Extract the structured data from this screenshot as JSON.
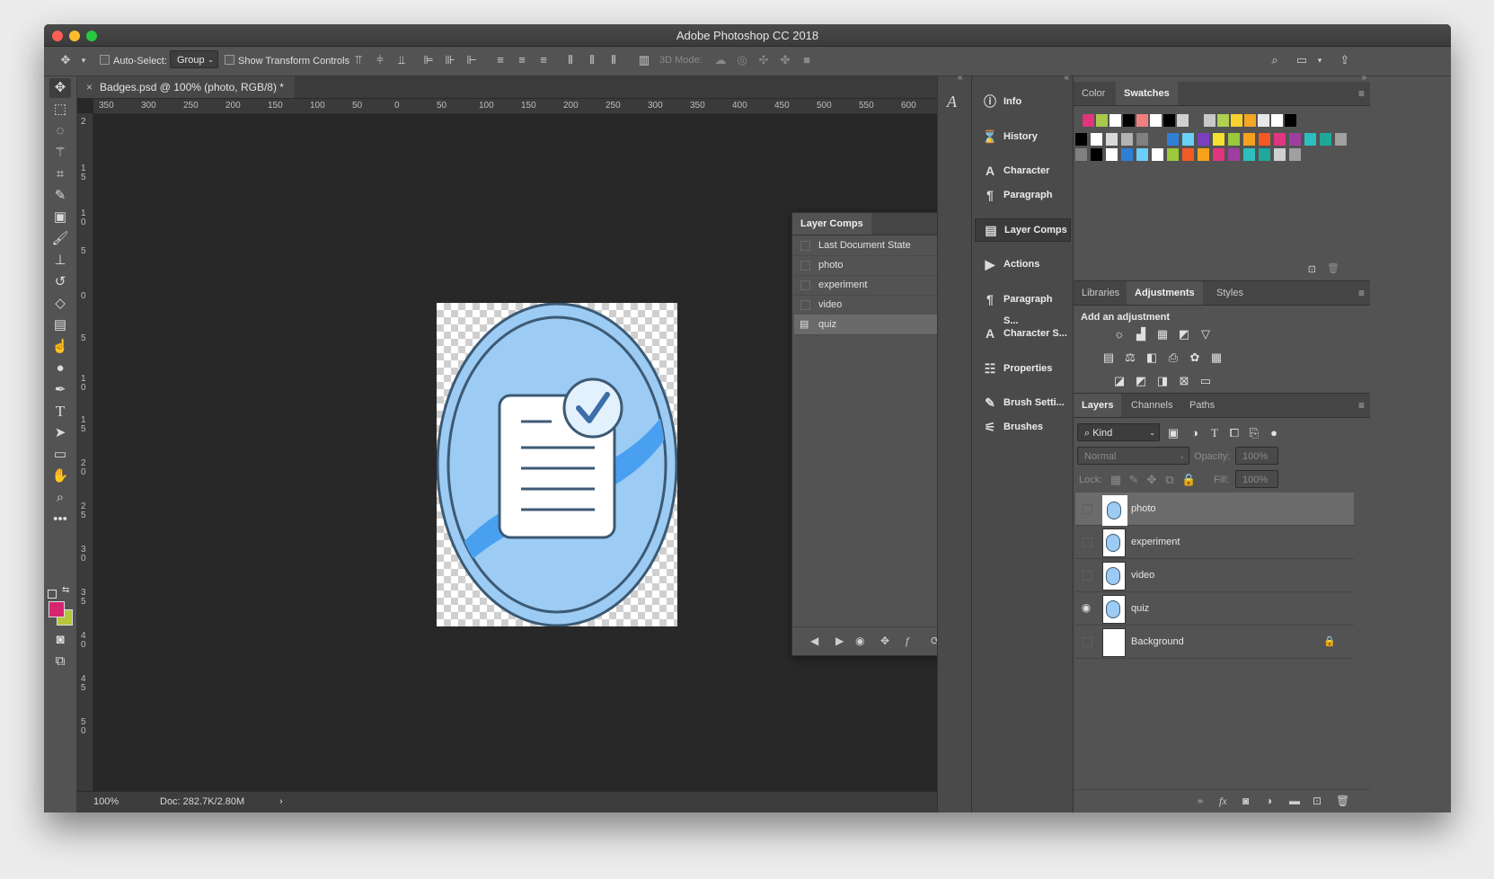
{
  "window": {
    "title": "Adobe Photoshop CC 2018"
  },
  "options": {
    "auto_select_label": "Auto-Select:",
    "auto_select_value": "Group",
    "show_transform_label": "Show Transform Controls",
    "mode_3d_label": "3D Mode:"
  },
  "document": {
    "tab_title": "Badges.psd @ 100% (photo, RGB/8) *",
    "zoom": "100%",
    "doc_size": "Doc: 282.7K/2.80M",
    "ruler_h": [
      "350",
      "300",
      "250",
      "200",
      "150",
      "100",
      "50",
      "0",
      "50",
      "100",
      "150",
      "200",
      "250",
      "300",
      "350",
      "400",
      "450",
      "500",
      "550",
      "600"
    ],
    "ruler_v": [
      "2",
      "1",
      "5",
      "1",
      "0",
      "5",
      "0",
      "5",
      "1",
      "0",
      "1",
      "5",
      "2",
      "0",
      "2",
      "5",
      "3",
      "0",
      "3",
      "5",
      "4",
      "0",
      "4",
      "5",
      "5",
      "0"
    ]
  },
  "layer_comps": {
    "title": "Layer Comps",
    "last_state": "Last Document State",
    "rows": [
      "photo",
      "experiment",
      "video",
      "quiz"
    ],
    "selected_index": 3
  },
  "collapsed_panels": [
    "Info",
    "History",
    "Character",
    "Paragraph",
    "Layer Comps",
    "Actions",
    "Paragraph S...",
    "Character S...",
    "Properties",
    "Brush Setti...",
    "Brushes"
  ],
  "color_panel": {
    "tabs": [
      "Color",
      "Swatches"
    ],
    "active": "Swatches",
    "recent": [
      "#e0357f",
      "#a8c94a",
      "#ffffff",
      "#000000",
      "#f08080",
      "#ffffff",
      "#000000",
      "#d0d0d0",
      "#535353",
      "#c8c8c8",
      "#b0d050",
      "#f6d22e",
      "#f5a623",
      "#e8e8e8",
      "#ffffff",
      "#000000"
    ],
    "row1": [
      "#000000",
      "#ffffff",
      "#d9d9d9",
      "#b3b3b3",
      "#808080",
      "#535353",
      "#2f7fd6",
      "#6ccff6",
      "#7a3fbf",
      "#f6e12e",
      "#9cc83c",
      "#f7a21c",
      "#f15a24",
      "#e0357f",
      "#9e3fa0",
      "#2dbfbf",
      "#1fa89a",
      "#a0a0a0"
    ],
    "row2": [
      "#808080",
      "#000000",
      "#ffffff",
      "#2f7fd6",
      "#6ccff6",
      "#ffffff",
      "#9cc83c",
      "#f15a24",
      "#f7a21c",
      "#e0357f",
      "#9e3fa0",
      "#2dbfbf",
      "#1fa89a",
      "#d0d0d0",
      "#a0a0a0",
      "#535353"
    ]
  },
  "adjustments": {
    "tabs": [
      "Libraries",
      "Adjustments",
      "Styles"
    ],
    "active": "Adjustments",
    "heading": "Add an adjustment"
  },
  "layers_panel": {
    "tabs": [
      "Layers",
      "Channels",
      "Paths"
    ],
    "active": "Layers",
    "filter": "Kind",
    "blend_mode": "Normal",
    "opacity_label": "Opacity:",
    "opacity_value": "100%",
    "lock_label": "Lock:",
    "fill_label": "Fill:",
    "fill_value": "100%",
    "layers": [
      {
        "name": "photo",
        "visible": false,
        "selected": true
      },
      {
        "name": "experiment",
        "visible": false,
        "selected": false
      },
      {
        "name": "video",
        "visible": false,
        "selected": false
      },
      {
        "name": "quiz",
        "visible": true,
        "selected": false
      },
      {
        "name": "Background",
        "visible": false,
        "selected": false,
        "locked": true
      }
    ]
  },
  "colors": {
    "foreground": "#d6246e",
    "background": "#b5c63a",
    "badge_fill": "#9ccbf3",
    "badge_stroke": "#3c5a74"
  }
}
